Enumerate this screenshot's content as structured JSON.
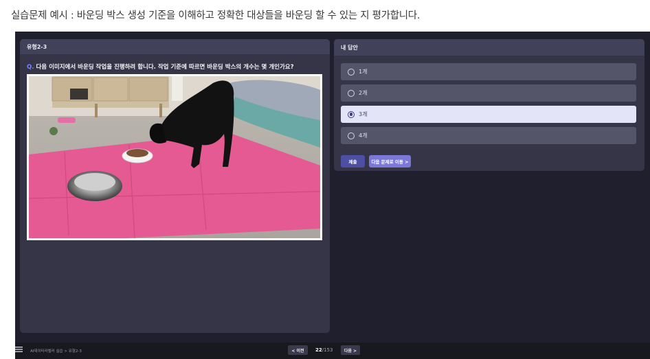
{
  "caption": "실습문제 예시 : 바운딩 박스 생성 기준을 이해하고 정확한 대상들을 바운딩 할 수 있는 지 평가합니다.",
  "left_panel": {
    "header": "유형2-3",
    "question_marker": "Q.",
    "question": "다음 이미지에서 바운딩 작업을 진행하려 합니다. 작업 기준에 따르면 바운딩 박스의 개수는 몇 개인가요?"
  },
  "right_panel": {
    "header": "내 답안",
    "options": [
      {
        "label": "1개",
        "selected": false
      },
      {
        "label": "2개",
        "selected": false
      },
      {
        "label": "3개",
        "selected": true
      },
      {
        "label": "4개",
        "selected": false
      }
    ],
    "submit_label": "제출",
    "next_question_label": "다음 문제로 이동 >"
  },
  "footer": {
    "menu_icon": "menu-icon",
    "breadcrumb": "AI데이터라벨러 실습 > 유형2-3",
    "prev_label": "< 이전",
    "current_page": "22",
    "total_pages": "/153",
    "next_label": "다음 >"
  },
  "colors": {
    "app_bg": "#1f1f2d",
    "panel_bg": "#353547",
    "selected_option": "#e4e4f8",
    "submit_button": "#4d4fa5",
    "next_button": "#7c78d8",
    "question_marker": "#7b87ff"
  }
}
